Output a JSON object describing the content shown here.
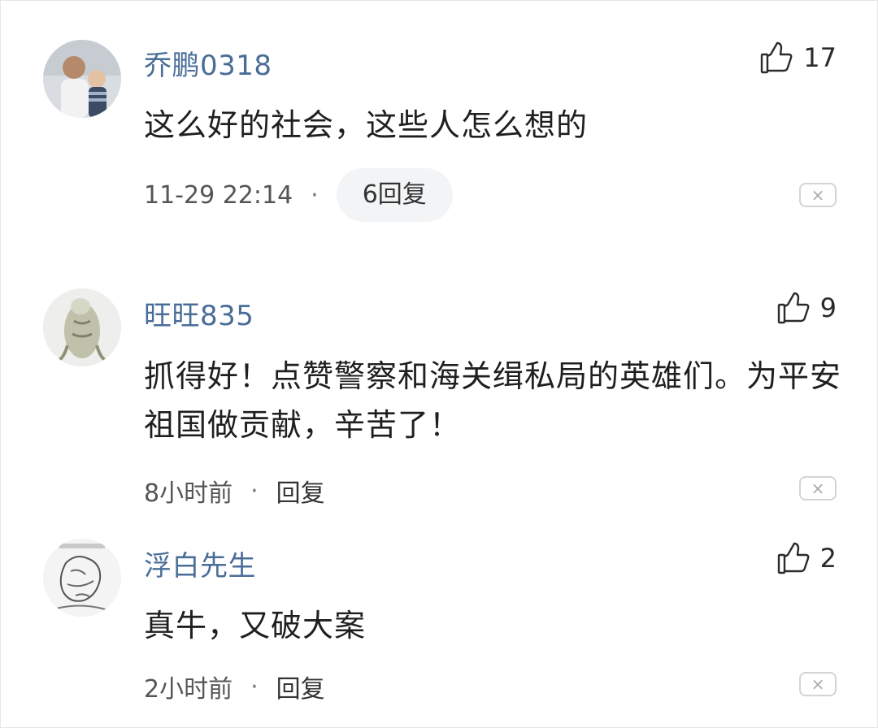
{
  "comments": [
    {
      "username": "乔鹏0318",
      "likes": "17",
      "text": "这么好的社会，这些人怎么想的",
      "time": "11-29 22:14",
      "separator": "·",
      "reply_label": "6回复",
      "dismiss": "×",
      "avatar_icon": "user-avatar-icon",
      "like_icon": "thumbs-up-icon"
    },
    {
      "username": "旺旺835",
      "likes": "9",
      "text": "抓得好！点赞警察和海关缉私局的英雄们。为平安祖国做贡献，辛苦了！",
      "time": "8小时前",
      "separator": "·",
      "reply_label": "回复",
      "dismiss": "×",
      "avatar_icon": "user-avatar-icon",
      "like_icon": "thumbs-up-icon"
    },
    {
      "username": "浮白先生",
      "likes": "2",
      "text": "真牛，又破大案",
      "time": "2小时前",
      "separator": "·",
      "reply_label": "回复",
      "dismiss": "×",
      "avatar_icon": "user-avatar-icon",
      "like_icon": "thumbs-up-icon"
    }
  ],
  "colors": {
    "username": "#4a6d98",
    "text": "#1f1f1f",
    "meta": "#555555",
    "pill_bg": "#f3f4f6"
  }
}
